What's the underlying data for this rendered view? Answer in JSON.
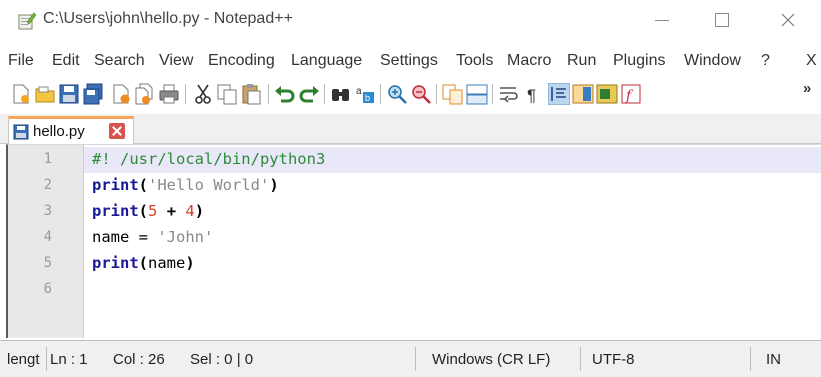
{
  "window": {
    "title": "C:\\Users\\john\\hello.py - Notepad++",
    "minimize_label": "—",
    "maximize_label": "☐",
    "close_label": "✕"
  },
  "menu": {
    "items": [
      "File",
      "Edit",
      "Search",
      "View",
      "Encoding",
      "Language",
      "Settings",
      "Tools",
      "Macro",
      "Run",
      "Plugins",
      "Window",
      "?"
    ],
    "close_x": "X"
  },
  "toolbar": {
    "overflow_label": "»",
    "icons": [
      "new-file-icon",
      "open-file-icon",
      "save-icon",
      "save-all-icon",
      "close-icon",
      "close-all-icon",
      "print-icon",
      "cut-icon",
      "copy-icon",
      "paste-icon",
      "undo-icon",
      "redo-icon",
      "find-icon",
      "replace-icon",
      "zoom-in-icon",
      "zoom-out-icon",
      "sync-v-icon",
      "sync-h-icon",
      "word-wrap-icon",
      "all-chars-icon",
      "indent-guide-icon",
      "doc-map-icon",
      "function-list-icon",
      "macro-record-icon"
    ]
  },
  "tabs": [
    {
      "label": "hello.py",
      "active": true
    }
  ],
  "editor": {
    "line_numbers": [
      "1",
      "2",
      "3",
      "4",
      "5",
      "6"
    ],
    "lines": [
      [
        {
          "text": "#! /usr/local/bin/python3",
          "cls": "c-comment"
        }
      ],
      [
        {
          "text": "print",
          "cls": "c-kw"
        },
        {
          "text": "(",
          "cls": "c-op"
        },
        {
          "text": "'Hello World'",
          "cls": "c-str"
        },
        {
          "text": ")",
          "cls": "c-op"
        }
      ],
      [
        {
          "text": "print",
          "cls": "c-kw"
        },
        {
          "text": "(",
          "cls": "c-op"
        },
        {
          "text": "5",
          "cls": "c-num"
        },
        {
          "text": " + ",
          "cls": "c-op"
        },
        {
          "text": "4",
          "cls": "c-num"
        },
        {
          "text": ")",
          "cls": "c-op"
        }
      ],
      [
        {
          "text": "name = ",
          "cls": "c-plain"
        },
        {
          "text": "'John'",
          "cls": "c-str"
        }
      ],
      [
        {
          "text": "print",
          "cls": "c-kw"
        },
        {
          "text": "(",
          "cls": "c-op"
        },
        {
          "text": "name",
          "cls": "c-plain"
        },
        {
          "text": ")",
          "cls": "c-op"
        }
      ],
      []
    ],
    "current_line": 1
  },
  "status": {
    "length": "lengt",
    "ln": "Ln : 1",
    "col": "Col : 26",
    "sel": "Sel : 0 | 0",
    "eol": "Windows (CR LF)",
    "encoding": "UTF-8",
    "mode": "IN"
  },
  "colors": {
    "tab_accent": "#f8a35a",
    "current_line_bg": "#e8e8f8",
    "keyword": "#1a1a99",
    "comment": "#2e8b3a",
    "string": "#8a8a8a",
    "number": "#e03c2a"
  }
}
